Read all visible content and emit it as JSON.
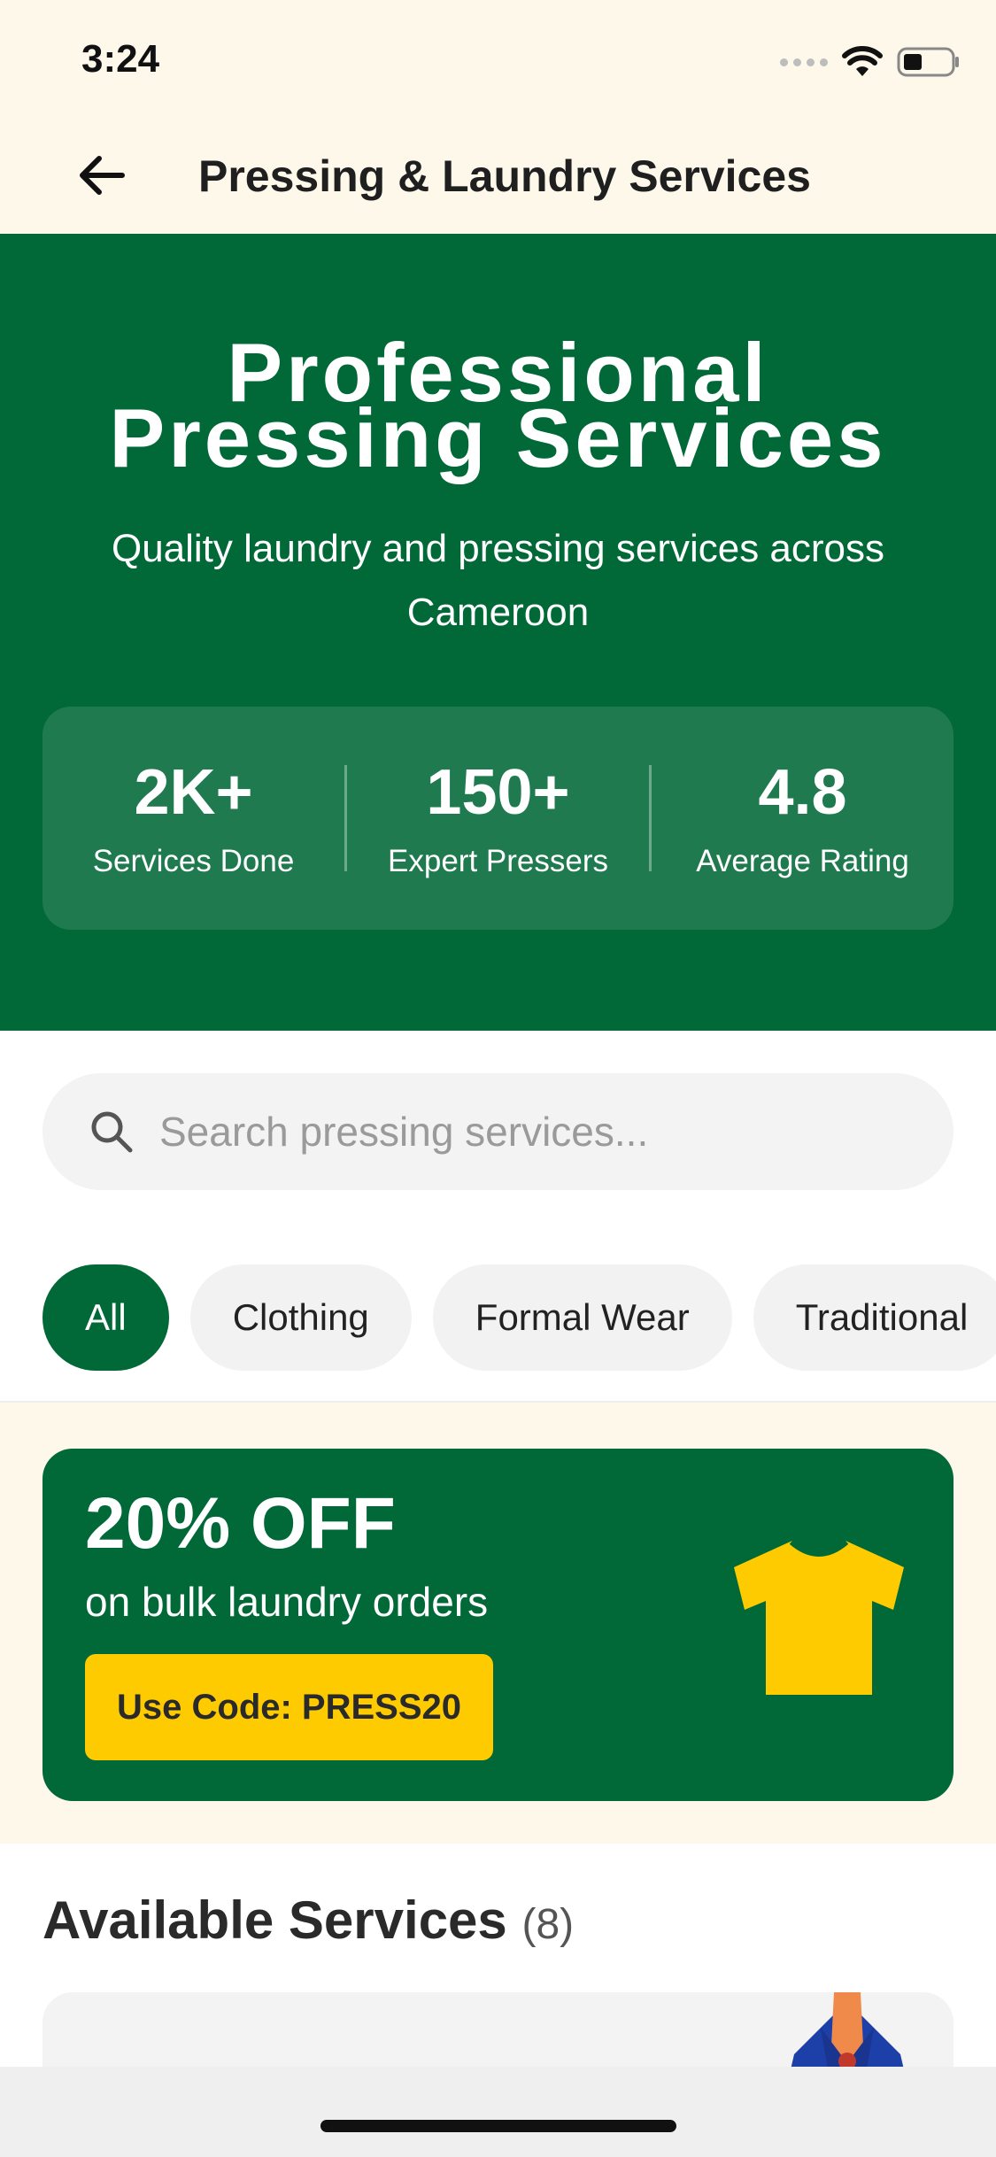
{
  "status_bar": {
    "time": "3:24"
  },
  "header": {
    "title": "Pressing & Laundry Services"
  },
  "hero": {
    "title_line1": "Professional",
    "title_line2": "Pressing Services",
    "subtitle": "Quality laundry and pressing services across Cameroon",
    "stats": [
      {
        "value": "2K+",
        "label": "Services Done"
      },
      {
        "value": "150+",
        "label": "Expert Pressers"
      },
      {
        "value": "4.8",
        "label": "Average Rating"
      }
    ]
  },
  "search": {
    "placeholder": "Search pressing services..."
  },
  "categories": [
    {
      "label": "All",
      "active": true
    },
    {
      "label": "Clothing",
      "active": false
    },
    {
      "label": "Formal Wear",
      "active": false
    },
    {
      "label": "Traditional",
      "active": false
    }
  ],
  "promo": {
    "title": "20% OFF",
    "subtitle": "on bulk laundry orders",
    "code_label": "Use Code: PRESS20"
  },
  "services": {
    "heading": "Available Services",
    "count": "(8)"
  },
  "colors": {
    "primary_green": "#016937",
    "accent_yellow": "#fecb00",
    "cream_bg": "#fdf8ea"
  }
}
